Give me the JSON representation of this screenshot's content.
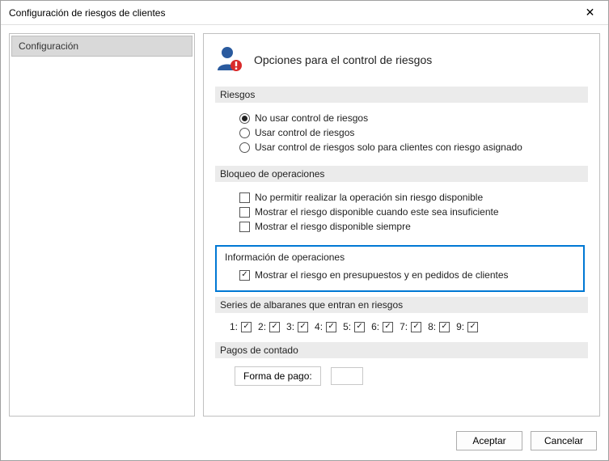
{
  "window": {
    "title": "Configuración de riesgos de clientes"
  },
  "nav": {
    "items": [
      {
        "label": "Configuración"
      }
    ]
  },
  "header": {
    "title": "Opciones para el control de riesgos"
  },
  "sections": {
    "riesgos": {
      "title": "Riesgos",
      "options": [
        {
          "label": "No usar control de riesgos",
          "selected": true
        },
        {
          "label": "Usar control de riesgos",
          "selected": false
        },
        {
          "label": "Usar control de riesgos solo para clientes con riesgo asignado",
          "selected": false
        }
      ]
    },
    "bloqueo": {
      "title": "Bloqueo de operaciones",
      "options": [
        {
          "label": "No permitir realizar la operación sin riesgo disponible",
          "checked": false
        },
        {
          "label": "Mostrar el riesgo disponible cuando este sea insuficiente",
          "checked": false
        },
        {
          "label": "Mostrar el riesgo disponible siempre",
          "checked": false
        }
      ]
    },
    "informacion": {
      "title": "Información de operaciones",
      "option": {
        "label": "Mostrar el riesgo en presupuestos y en pedidos de clientes",
        "checked": true
      }
    },
    "series": {
      "title": "Series de albaranes que entran en riesgos",
      "items": [
        {
          "label": "1:",
          "checked": true
        },
        {
          "label": "2:",
          "checked": true
        },
        {
          "label": "3:",
          "checked": true
        },
        {
          "label": "4:",
          "checked": true
        },
        {
          "label": "5:",
          "checked": true
        },
        {
          "label": "6:",
          "checked": true
        },
        {
          "label": "7:",
          "checked": true
        },
        {
          "label": "8:",
          "checked": true
        },
        {
          "label": "9:",
          "checked": true
        }
      ]
    },
    "pagos": {
      "title": "Pagos de contado",
      "label": "Forma de pago:",
      "value": ""
    }
  },
  "footer": {
    "ok": "Aceptar",
    "cancel": "Cancelar"
  }
}
